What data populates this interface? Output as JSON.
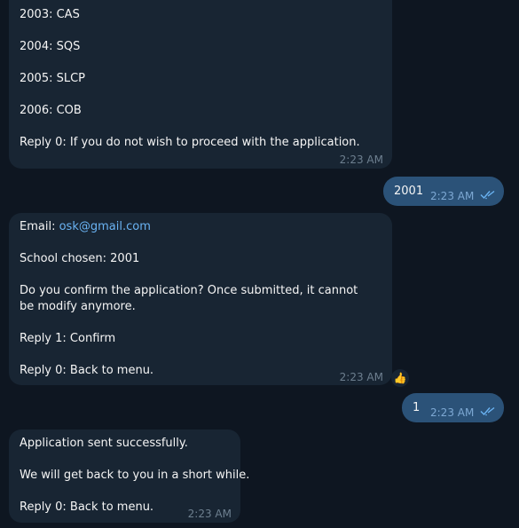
{
  "messages": {
    "m1": {
      "lines": [
        "2003: CAS",
        "2004: SQS",
        "2005: SLCP",
        "2006: COB",
        "Reply 0: If you do not wish to proceed with the application."
      ],
      "time": "2:23 AM"
    },
    "m2": {
      "text": "2001",
      "time": "2:23 AM"
    },
    "m3": {
      "email_label": "Email: ",
      "email": "osk@gmail.com",
      "school": "School chosen: 2001",
      "confirm_q": "Do you confirm the application? Once submitted, it cannot be modify anymore.",
      "reply1": "Reply 1: Confirm",
      "reply0": "Reply 0: Back to menu.",
      "time": "2:23 AM",
      "reaction": "👍"
    },
    "m4": {
      "text": "1",
      "time": "2:23 AM"
    },
    "m5": {
      "lines": [
        "Application sent successfully.",
        "We will get back to you in a short while.",
        "Reply 0: Back to menu."
      ],
      "time": "2:23 AM"
    }
  },
  "colors": {
    "background": "#0e1621",
    "incoming_bubble": "#182533",
    "outgoing_bubble": "#2b5278",
    "link": "#6ab3f3",
    "read_ticks": "#6ab3f3"
  },
  "icons": {
    "read_status": "double-check-icon",
    "reaction": "thumbs-up-emoji"
  }
}
